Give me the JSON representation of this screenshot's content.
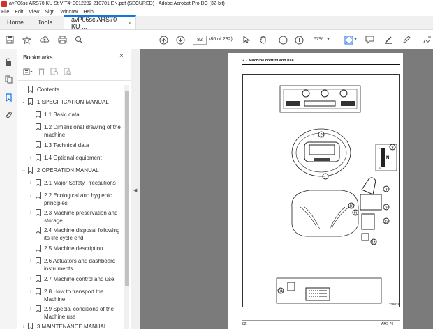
{
  "window": {
    "title": "avP06sc ARS70 KU St V T4f 3012282 210701 EN.pdf (SECURED) - Adobe Acrobat Pro DC (32-bit)"
  },
  "menu": {
    "items": [
      "File",
      "Edit",
      "View",
      "Sign",
      "Window",
      "Help"
    ]
  },
  "tabs": {
    "home": "Home",
    "tools": "Tools",
    "document": "avP06sc ARS70 KU ...",
    "close_symbol": "×"
  },
  "toolbar": {
    "page_number": "82",
    "page_count": "(86 of 232)",
    "zoom": "57%"
  },
  "panel": {
    "title": "Bookmarks",
    "close_symbol": "×"
  },
  "bookmarks": [
    {
      "label": "Contents",
      "arrow": "",
      "indent": 0
    },
    {
      "label": "1 SPECIFICATION MANUAL",
      "arrow": "⌄",
      "indent": 0
    },
    {
      "label": "1.1 Basic data",
      "arrow": "",
      "indent": 1
    },
    {
      "label": "1.2 Dimensional drawing of the machine",
      "arrow": "",
      "indent": 1
    },
    {
      "label": "1.3 Technical data",
      "arrow": "",
      "indent": 1
    },
    {
      "label": "1.4 Optional equipment",
      "arrow": "›",
      "indent": 1
    },
    {
      "label": "2 OPERATION MANUAL",
      "arrow": "⌄",
      "indent": 0
    },
    {
      "label": "2.1 Major Safety Precautions",
      "arrow": "›",
      "indent": 1
    },
    {
      "label": "2.2 Ecological and hygienic principles",
      "arrow": "›",
      "indent": 1
    },
    {
      "label": "2.3 Machine preservation and storage",
      "arrow": "›",
      "indent": 1
    },
    {
      "label": "2.4 Machine disposal following its life cycle end",
      "arrow": "",
      "indent": 1
    },
    {
      "label": "2.5 Machine description",
      "arrow": "",
      "indent": 1
    },
    {
      "label": "2.6 Actuators and dashboard instruments",
      "arrow": "›",
      "indent": 1
    },
    {
      "label": "2.7 Machine control and use",
      "arrow": "›",
      "indent": 1
    },
    {
      "label": "2.8 How to transport the Machine",
      "arrow": "›",
      "indent": 1
    },
    {
      "label": "2.9 Special conditions of the Machine use",
      "arrow": "›",
      "indent": 1
    },
    {
      "label": "3 MAINTENANCE MANUAL",
      "arrow": "›",
      "indent": 0
    }
  ],
  "pdf": {
    "section": "2.7      Machine control and use",
    "footer_page": "82",
    "footer_model": "ARS 70",
    "figure_id": "238018",
    "callouts": [
      "2",
      "3",
      "3",
      "9",
      "10",
      "11",
      "12",
      "14",
      "34"
    ],
    "gear_letters": [
      "F",
      "N",
      "R"
    ]
  }
}
